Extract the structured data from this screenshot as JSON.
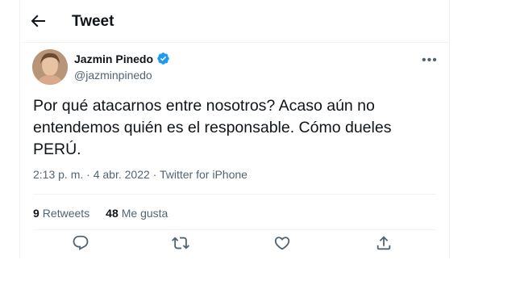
{
  "header": {
    "title": "Tweet"
  },
  "author": {
    "name": "Jazmin Pinedo",
    "handle": "@jazminpinedo"
  },
  "tweet": {
    "text": "Por qué atacarnos entre nosotros? Acaso aún no entendemos quién es el responsable. Cómo dueles PERÚ.",
    "time": "2:13 p. m.",
    "date": "4 abr. 2022",
    "source": "Twitter for iPhone",
    "separator": " · "
  },
  "stats": {
    "retweets_count": "9",
    "retweets_label": "Retweets",
    "likes_count": "48",
    "likes_label": "Me gusta"
  },
  "icons": {
    "back": "arrow-left-icon",
    "verified": "verified-badge-icon",
    "more": "more-icon",
    "reply": "reply-icon",
    "retweet": "retweet-icon",
    "like": "heart-icon",
    "share": "share-icon"
  },
  "colors": {
    "verified": "#1d9bf0",
    "text": "#0f1419",
    "secondary": "#536471",
    "border": "#eff3f4"
  }
}
